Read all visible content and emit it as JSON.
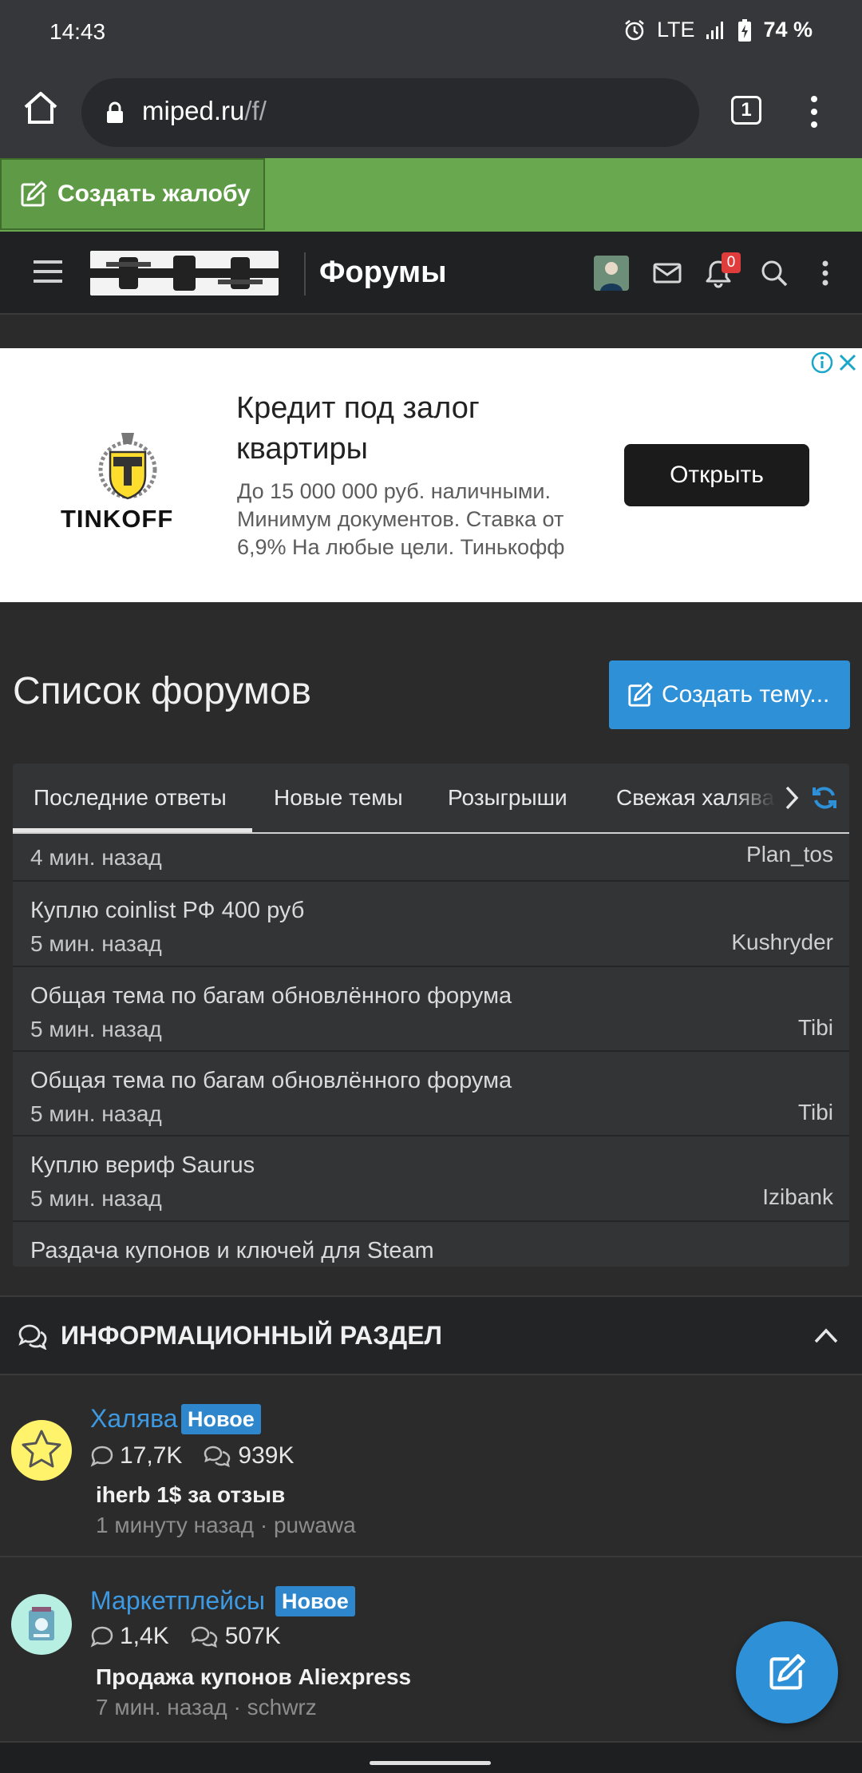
{
  "status_bar": {
    "time": "14:43",
    "network": "LTE",
    "battery": "74 %"
  },
  "browser": {
    "url_host": "miped.ru",
    "url_path": "/f/",
    "tab_count": "1"
  },
  "complaint": {
    "label": "Создать жалобу"
  },
  "header": {
    "title": "Форумы",
    "notification_count": "0"
  },
  "ad": {
    "brand": "TINKOFF",
    "title": "Кредит под залог квартиры",
    "description": "До 15 000 000 руб. наличными. Минимум документов. Ставка от 6,9% На любые цели. Тинькофф",
    "button": "Открыть"
  },
  "page": {
    "heading": "Список форумов",
    "create_topic": "Создать тему..."
  },
  "tabs": [
    {
      "label": "Последние ответы"
    },
    {
      "label": "Новые темы"
    },
    {
      "label": "Розыгрыши"
    },
    {
      "label": "Свежая халява"
    }
  ],
  "recent": [
    {
      "title": "",
      "time": "4 мин. назад",
      "user": "Plan_tos"
    },
    {
      "title": "Куплю coinlist РФ 400 руб",
      "time": "5 мин. назад",
      "user": "Kushryder"
    },
    {
      "title": "Общая тема по багам обновлённого форума",
      "time": "5 мин. назад",
      "user": "Tibi"
    },
    {
      "title": "Общая тема по багам обновлённого форума",
      "time": "5 мин. назад",
      "user": "Tibi"
    },
    {
      "title": "Куплю вериф Saurus",
      "time": "5 мин. назад",
      "user": "Izibank"
    },
    {
      "title": "Раздача купонов и ключей для Steam",
      "time": "",
      "user": ""
    }
  ],
  "section": {
    "title": "ИНФОРМАЦИОННЫЙ РАЗДЕЛ"
  },
  "forums": [
    {
      "name": "Халява",
      "badge": "Новое",
      "threads": "17,7K",
      "messages": "939K",
      "last_title": "iherb 1$ за отзыв",
      "last_meta": "1 минуту назад · puwawa"
    },
    {
      "name": "Маркетплейсы",
      "badge": "Новое",
      "threads": "1,4K",
      "messages": "507K",
      "last_title": "Продажа купонов Aliexpress",
      "last_meta": "7 мин. назад · schwrz"
    }
  ],
  "colors": {
    "accent": "#2e90d6",
    "complaint_green": "#6aa84f",
    "link_blue": "#3d9ae2",
    "notification_red": "#e03c3c"
  }
}
